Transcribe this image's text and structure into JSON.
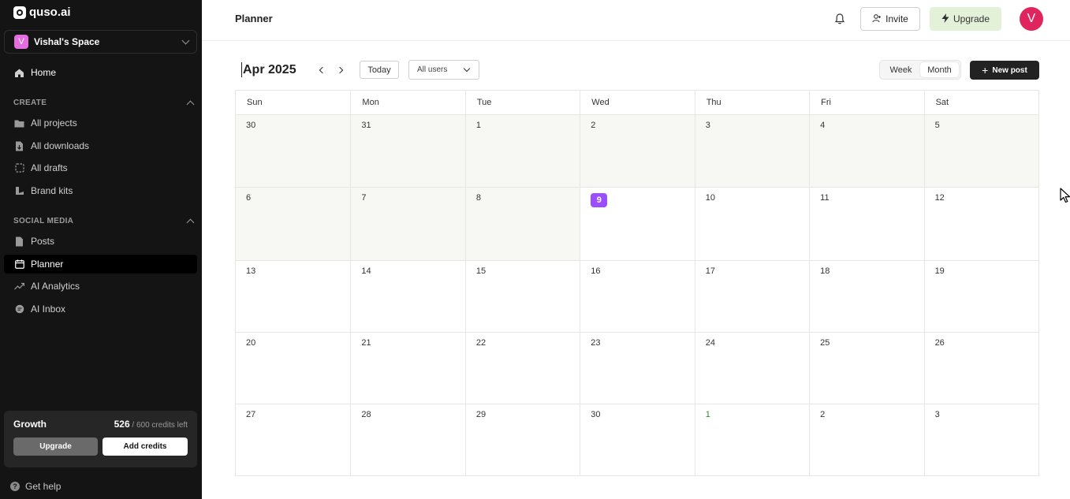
{
  "brand": {
    "name": "quso.ai"
  },
  "workspace": {
    "initial": "V",
    "name": "Vishal's Space"
  },
  "sidebar": {
    "home": "Home",
    "create_label": "CREATE",
    "create_items": [
      "All projects",
      "All downloads",
      "All drafts",
      "Brand kits"
    ],
    "social_label": "SOCIAL MEDIA",
    "social_items": [
      "Posts",
      "Planner",
      "AI Analytics",
      "AI Inbox"
    ],
    "active_item": "Planner"
  },
  "plan": {
    "name": "Growth",
    "credits_used": "526",
    "credits_rest": " / 600 credits left",
    "upgrade_label": "Upgrade",
    "add_credits_label": "Add credits"
  },
  "help_label": "Get help",
  "header": {
    "title": "Planner",
    "invite_label": "Invite",
    "upgrade_label": "Upgrade",
    "avatar_initial": "V"
  },
  "toolbar": {
    "month_label": "Apr 2025",
    "today_label": "Today",
    "users_select": "All users",
    "views": [
      "Week",
      "Month"
    ],
    "active_view": "Month",
    "new_post_label": "New post"
  },
  "calendar": {
    "weekdays": [
      "Sun",
      "Mon",
      "Tue",
      "Wed",
      "Thu",
      "Fri",
      "Sat"
    ],
    "today": "9",
    "weeks": [
      [
        "30",
        "31",
        "1",
        "2",
        "3",
        "4",
        "5"
      ],
      [
        "6",
        "7",
        "8",
        "9",
        "10",
        "11",
        "12"
      ],
      [
        "13",
        "14",
        "15",
        "16",
        "17",
        "18",
        "19"
      ],
      [
        "20",
        "21",
        "22",
        "23",
        "24",
        "25",
        "26"
      ],
      [
        "27",
        "28",
        "29",
        "30",
        "1",
        "2",
        "3"
      ]
    ]
  },
  "colors": {
    "sidebar_bg": "#141414",
    "today_accent": "#9b4dff",
    "avatar": "#e0245e",
    "upgrade_bg": "#e3f1d9",
    "workspace_avatar": "#e46de0"
  }
}
